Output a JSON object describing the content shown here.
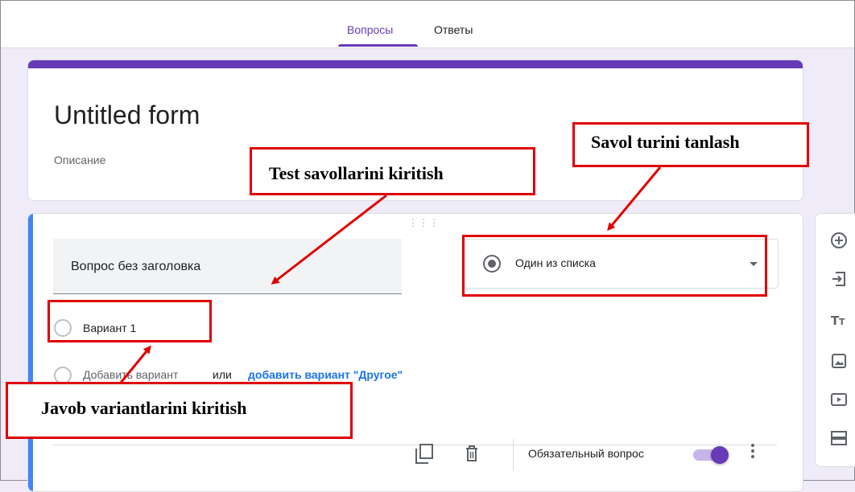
{
  "tabs": {
    "questions": "Вопросы",
    "responses": "Ответы"
  },
  "form": {
    "title": "Untitled form",
    "description": "Описание"
  },
  "question": {
    "title_placeholder": "Вопрос без заголовка",
    "type_label": "Один из списка",
    "options": [
      "Вариант 1"
    ],
    "add_option": "Добавить вариант",
    "or_text": "или",
    "add_other": "добавить вариант \"Другое\"",
    "required_label": "Обязательный вопрос",
    "required": true
  },
  "annotations": {
    "type_choice": "Savol turini tanlash",
    "questions_entry": "Test savollarini kiritish",
    "answers_entry": "Javob variantlarini kiritish"
  },
  "colors": {
    "accent": "#673ab7",
    "left_bar": "#4285f4",
    "link": "#1a73e8",
    "annotation": "#e00000",
    "background": "#f0ebf8"
  },
  "sidebar_icons": [
    "add-question-icon",
    "import-questions-icon",
    "add-title-icon",
    "add-image-icon",
    "add-video-icon",
    "add-section-icon"
  ]
}
